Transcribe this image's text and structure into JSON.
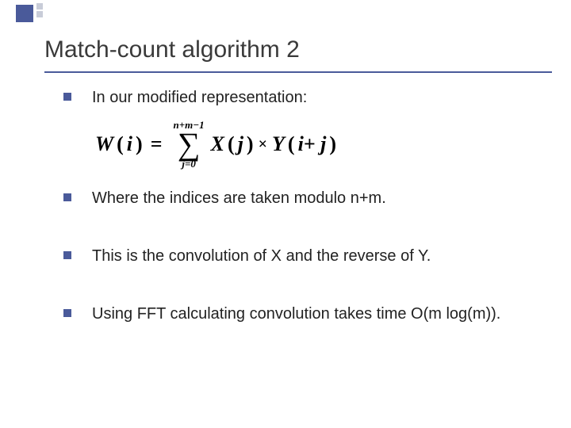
{
  "title": "Match-count algorithm 2",
  "bullets": {
    "b1": "In our modified representation:",
    "b2": "Where the indices are taken modulo n+m.",
    "b3": "This is the convolution of X and the reverse of Y.",
    "b4": "Using FFT calculating convolution takes time O(m log(m))."
  },
  "formula": {
    "lhs_func": "W",
    "lhs_arg": "i",
    "sum_lower": "j=0",
    "sum_upper": "n+m−1",
    "term1_func": "X",
    "term1_arg": "j",
    "term2_func": "Y",
    "term2_arg": "i+ j"
  }
}
